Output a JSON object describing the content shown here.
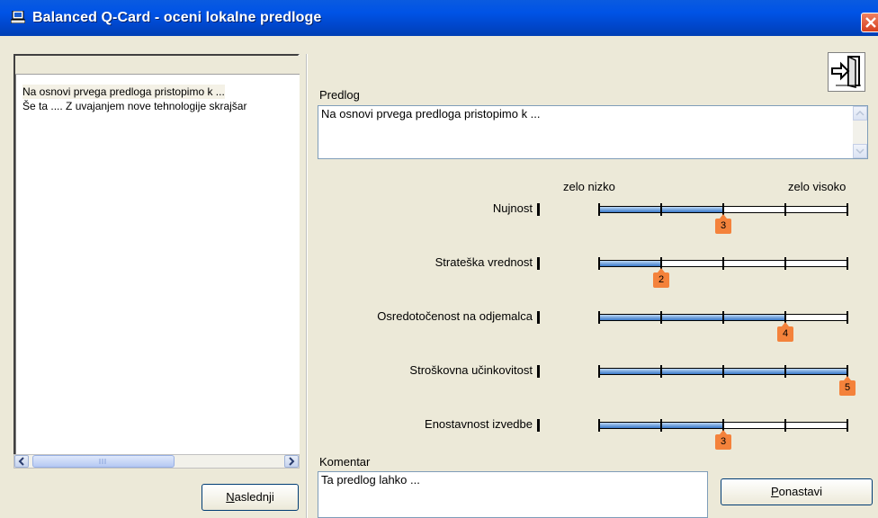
{
  "window": {
    "title": "Balanced Q-Card - oceni lokalne predloge",
    "icon": "computer-icon",
    "close_icon": "close-icon",
    "accent_color": "#0053e6"
  },
  "left_list": {
    "items": [
      {
        "label": "Na osnovi prvega predloga pristopimo k ...",
        "selected": true
      },
      {
        "label": "Še ta .... Z uvajanjem nove tehnologije skrajšar",
        "selected": false
      }
    ]
  },
  "buttons": {
    "next_label": "Naslednji",
    "reset_label": "Ponastavi"
  },
  "proposal": {
    "label": "Predlog",
    "value": "Na osnovi prvega predloga pristopimo k ..."
  },
  "scale": {
    "low_label": "zelo nizko",
    "high_label": "zelo visoko",
    "min": 1,
    "max": 5,
    "fill_color": "#3a78c8",
    "pointer_color": "#f4823b"
  },
  "criteria": [
    {
      "label": "Nujnost",
      "value": 3
    },
    {
      "label": "Strateška vrednost",
      "value": 2
    },
    {
      "label": "Osredotočenost na odjemalca",
      "value": 4
    },
    {
      "label": "Stroškovna učinkovitost",
      "value": 5
    },
    {
      "label": "Enostavnost izvedbe",
      "value": 3
    }
  ],
  "comment": {
    "label": "Komentar",
    "value": "Ta predlog lahko ..."
  },
  "exit_icon": "exit-door-icon"
}
